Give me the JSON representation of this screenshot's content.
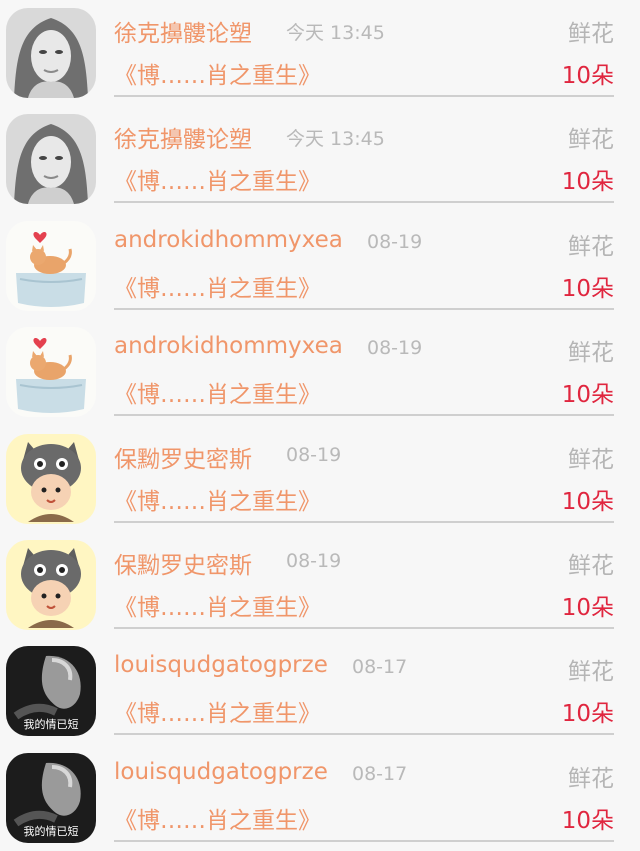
{
  "rows": [
    {
      "name": "徐克擤髏论塑",
      "time": "今天 13:45",
      "gift": "鲜花",
      "book": "《博……肖之重生》",
      "amount": "10朵",
      "avatar": "portrait-avatar"
    },
    {
      "name": "徐克擤髏论塑",
      "time": "今天 13:45",
      "gift": "鲜花",
      "book": "《博……肖之重生》",
      "amount": "10朵",
      "avatar": "portrait-avatar"
    },
    {
      "name": "androkidhommyxea",
      "time": "08-19",
      "gift": "鲜花",
      "book": "《博……肖之重生》",
      "amount": "10朵",
      "avatar": "cat-avatar"
    },
    {
      "name": "androkidhommyxea",
      "time": "08-19",
      "gift": "鲜花",
      "book": "《博……肖之重生》",
      "amount": "10朵",
      "avatar": "cat-avatar"
    },
    {
      "name": "保黝罗史密斯",
      "time": "08-19",
      "gift": "鲜花",
      "book": "《博……肖之重生》",
      "amount": "10朵",
      "avatar": "cartoon-avatar"
    },
    {
      "name": "保黝罗史密斯",
      "time": "08-19",
      "gift": "鲜花",
      "book": "《博……肖之重生》",
      "amount": "10朵",
      "avatar": "cartoon-avatar"
    },
    {
      "name": "louisqudgatogprze",
      "time": "08-17",
      "gift": "鲜花",
      "book": "《博……肖之重生》",
      "amount": "10朵",
      "avatar": "bw-photo-avatar",
      "avatar_caption": "我的情已短"
    },
    {
      "name": "louisqudgatogprze",
      "time": "08-17",
      "gift": "鲜花",
      "book": "《博……肖之重生》",
      "amount": "10朵",
      "avatar": "bw-photo-avatar",
      "avatar_caption": "我的情已短"
    }
  ],
  "colors": {
    "name": "#f0966a",
    "time": "#b9b9b9",
    "gift": "#b5b5b5",
    "amount": "#e0263f",
    "divider": "#cfcfcf",
    "background": "#f7f7f7"
  }
}
